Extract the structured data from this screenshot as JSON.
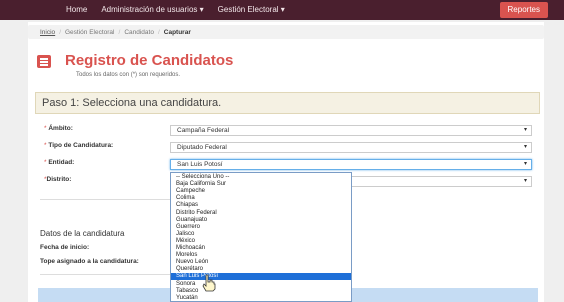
{
  "topnav": {
    "home": "Home",
    "usuarios": "Administración de usuarios ▾",
    "electoral": "Gestión Electoral ▾",
    "reportes": "Reportes"
  },
  "breadcrumb": {
    "inicio": "Inicio",
    "gestion": "Gestión Electoral",
    "candidato": "Candidato",
    "capturar": "Capturar"
  },
  "header": {
    "title": "Registro de Candidatos",
    "subtitle": "Todos los datos con (*) son requeridos."
  },
  "step": {
    "title": "Paso 1: Selecciona una candidatura."
  },
  "form": {
    "ambito": {
      "label": "Ámbito:",
      "value": "Campaña Federal"
    },
    "tipo": {
      "label": "Tipo de Candidatura:",
      "value": "Diputado Federal"
    },
    "entidad": {
      "label": "Entidad:",
      "value": "San Luis Potosí"
    },
    "distrito": {
      "label": "Distrito:"
    }
  },
  "candidatura": {
    "title": "Datos de la candidatura",
    "fecha_label": "Fecha de inicio:",
    "tope_label": "Tope asignado a la candidatura:"
  },
  "dropdown": {
    "options": [
      "-- Selecciona Uno --",
      "Baja California Sur",
      "Campeche",
      "Colima",
      "Chiapas",
      "Distrito Federal",
      "Guanajuato",
      "Guerrero",
      "Jalisco",
      "México",
      "Michoacán",
      "Morelos",
      "Nuevo León",
      "Querétaro",
      "San Luis Potosí",
      "Sonora",
      "Tabasco",
      "Yucatán"
    ],
    "selected_index": 14
  },
  "colors": {
    "brand_dark": "#4a1f2e",
    "accent_red": "#d9534f",
    "highlight_blue": "#1e6fd8"
  }
}
